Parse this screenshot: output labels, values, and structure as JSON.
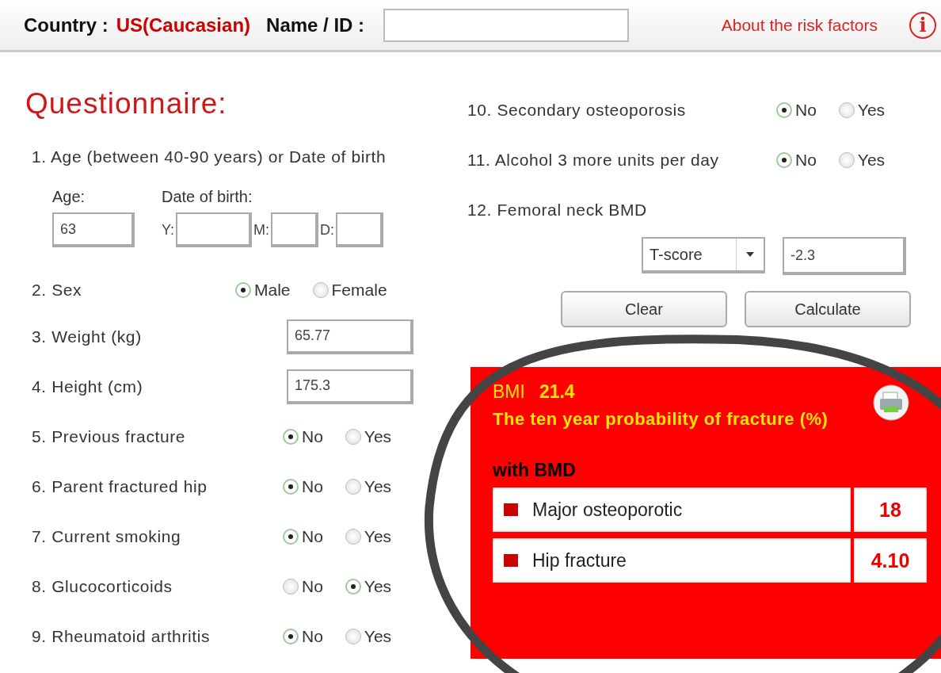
{
  "header": {
    "country_label": "Country :",
    "country": "US(Caucasian)",
    "name_label": "Name / ID :",
    "link": "About the risk factors",
    "info_icon": "i"
  },
  "title": "Questionnaire:",
  "left_questions": [
    {
      "kind": "age",
      "label": "1. Age (between 40-90 years) or Date of birth",
      "age_label": "Age:",
      "age": "63",
      "dob_label": "Date of birth:",
      "dob_parts": [
        {
          "label": "Y:"
        },
        {
          "label": "M:"
        },
        {
          "label": "D:"
        }
      ]
    },
    {
      "kind": "radio",
      "label": "2. Sex",
      "options": [
        {
          "label": "Male",
          "selected": true
        },
        {
          "label": "Female",
          "selected": false
        }
      ]
    },
    {
      "kind": "number",
      "label": "3. Weight (kg)",
      "value": "65.77"
    },
    {
      "kind": "number",
      "label": "4. Height (cm)",
      "value": "175.3"
    },
    {
      "kind": "radio",
      "label": "5. Previous fracture",
      "options": [
        {
          "label": "No",
          "selected": true
        },
        {
          "label": "Yes",
          "selected": false
        }
      ]
    },
    {
      "kind": "radio",
      "label": "6. Parent fractured hip",
      "options": [
        {
          "label": "No",
          "selected": true
        },
        {
          "label": "Yes",
          "selected": false
        }
      ]
    },
    {
      "kind": "radio",
      "label": "7. Current smoking",
      "options": [
        {
          "label": "No",
          "selected": true
        },
        {
          "label": "Yes",
          "selected": false
        }
      ]
    },
    {
      "kind": "radio",
      "label": "8. Glucocorticoids",
      "options": [
        {
          "label": "No",
          "selected": false
        },
        {
          "label": "Yes",
          "selected": true
        }
      ]
    },
    {
      "kind": "radio",
      "label": "9. Rheumatoid arthritis",
      "options": [
        {
          "label": "No",
          "selected": true
        },
        {
          "label": "Yes",
          "selected": false
        }
      ]
    }
  ],
  "right_questions": [
    {
      "kind": "radio",
      "label": "10. Secondary osteoporosis",
      "options": [
        {
          "label": "No",
          "selected": true
        },
        {
          "label": "Yes",
          "selected": false
        }
      ]
    },
    {
      "kind": "radio",
      "label": "11. Alcohol 3 more units per day",
      "options": [
        {
          "label": "No",
          "selected": true
        },
        {
          "label": "Yes",
          "selected": false
        }
      ]
    },
    {
      "kind": "bmd",
      "label": "12. Femoral neck BMD",
      "select": "T-score",
      "value": "-2.3"
    }
  ],
  "buttons": [
    "Clear",
    "Calculate"
  ],
  "result": {
    "bmi_label": "BMI",
    "bmi": "21.4",
    "heading": "The ten year probability of fracture (%)",
    "section": "with BMD",
    "rows": [
      {
        "label": "Major osteoporotic",
        "value": "18"
      },
      {
        "label": "Hip fracture",
        "value": "4.10"
      }
    ]
  }
}
